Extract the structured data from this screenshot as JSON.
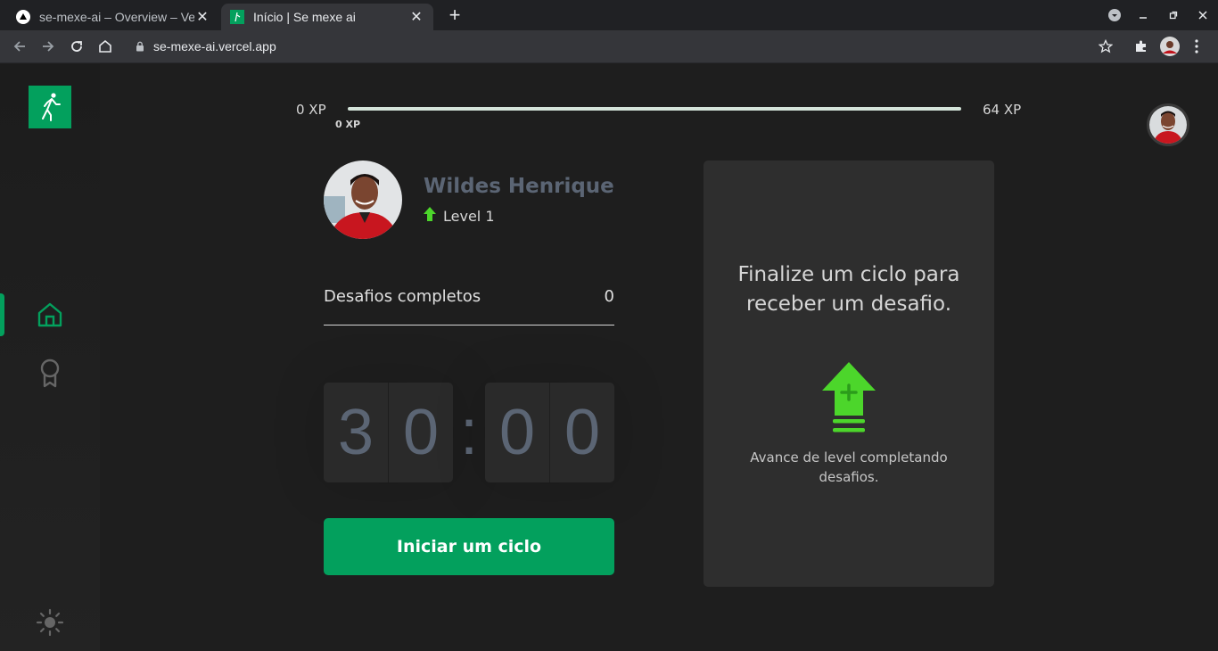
{
  "browser": {
    "tabs": [
      {
        "title": "se-mexe-ai – Overview – Vercel",
        "active": false,
        "icon": "vercel-triangle-icon"
      },
      {
        "title": "Início | Se mexe ai",
        "active": true,
        "icon": "app-logo-icon"
      }
    ],
    "new_tab_label": "+",
    "url": "se-mexe-ai.vercel.app"
  },
  "xp": {
    "min_label": "0 XP",
    "max_label": "64 XP",
    "current_label": "0 XP",
    "current": 0,
    "max": 64
  },
  "profile": {
    "name": "Wildes Henrique",
    "level_label": "Level 1"
  },
  "challenges": {
    "completed_label": "Desafios completos",
    "completed_count": "0"
  },
  "countdown": {
    "minute_left": "3",
    "minute_right": "0",
    "separator": ":",
    "second_left": "0",
    "second_right": "0"
  },
  "start_button": {
    "label": "Iniciar um ciclo"
  },
  "challenge_box": {
    "title": "Finalize um ciclo para receber um desafio.",
    "description": "Avance de level completando desafios."
  },
  "colors": {
    "accent": "#03a05d",
    "level_up": "#4cd62b",
    "background": "#1e1e1e",
    "card": "#2e2e2e",
    "text_muted": "#5b6574"
  }
}
